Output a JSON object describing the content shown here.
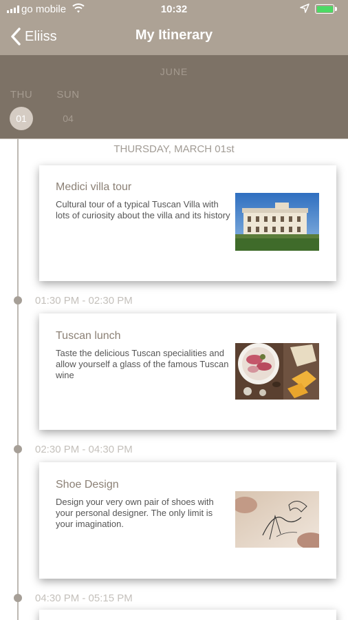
{
  "status_bar": {
    "carrier": "go mobile",
    "time": "10:32",
    "battery_color": "#4cd964"
  },
  "nav": {
    "back_label": "Eliiss",
    "title": "My Itinerary"
  },
  "calendar": {
    "month": "JUNE",
    "days": [
      {
        "day": "THU",
        "date": "01",
        "selected": true
      },
      {
        "day": "SUN",
        "date": "04",
        "selected": false
      }
    ]
  },
  "itinerary": {
    "date_header": "THURSDAY, MARCH 01st",
    "events": [
      {
        "title": "Medici villa tour",
        "description": "Cultural tour of a typical Tuscan Villa with lots of curiosity about the villa and its history",
        "image": "villa-photo"
      },
      {
        "time": "01:30 PM  -  02:30 PM",
        "title": "Tuscan lunch",
        "description": "Taste the delicious Tuscan specialities and allow yourself a glass of the famous Tuscan wine",
        "image": "food-photo"
      },
      {
        "time": "02:30 PM  -  04:30 PM",
        "title": "Shoe Design",
        "description": "Design your very own pair of shoes with your personal designer. The only limit is your imagination.",
        "image": "shoe-sketch-photo"
      },
      {
        "time": "04:30 PM  -  05:15 PM"
      }
    ]
  },
  "colors": {
    "header": "#ada295",
    "calendar": "#7d7266",
    "accent": "#a69f97"
  }
}
